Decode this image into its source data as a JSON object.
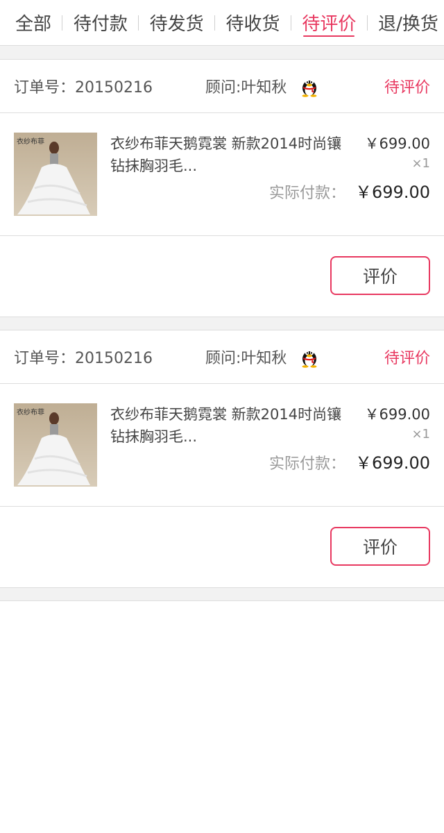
{
  "tabs": [
    {
      "label": "全部"
    },
    {
      "label": "待付款"
    },
    {
      "label": "待发货"
    },
    {
      "label": "待收货"
    },
    {
      "label": "待评价",
      "active": true
    },
    {
      "label": "退/换货"
    }
  ],
  "orders": [
    {
      "order_no": "订单号：20150216",
      "advisor": "顾问:叶知秋",
      "status": "待评价",
      "item": {
        "thumb_brand": "衣纱布菲",
        "title": "衣纱布菲天鹅霓裳 新款2014时尚镶钻抹胸羽毛...",
        "price": "￥699.00",
        "qty": "×1"
      },
      "paid_label": "实际付款：",
      "paid_value": "￥699.00",
      "button_label": "评价"
    },
    {
      "order_no": "订单号：20150216",
      "advisor": "顾问:叶知秋",
      "status": "待评价",
      "item": {
        "thumb_brand": "衣纱布菲",
        "title": "衣纱布菲天鹅霓裳 新款2014时尚镶钻抹胸羽毛...",
        "price": "￥699.00",
        "qty": "×1"
      },
      "paid_label": "实际付款：",
      "paid_value": "￥699.00",
      "button_label": "评价"
    }
  ],
  "colors": {
    "accent": "#e8375f",
    "divider": "#dddddd",
    "gap_bg": "#f2f2f2"
  },
  "icons": {
    "advisor_icon": "qq-penguin-icon"
  }
}
